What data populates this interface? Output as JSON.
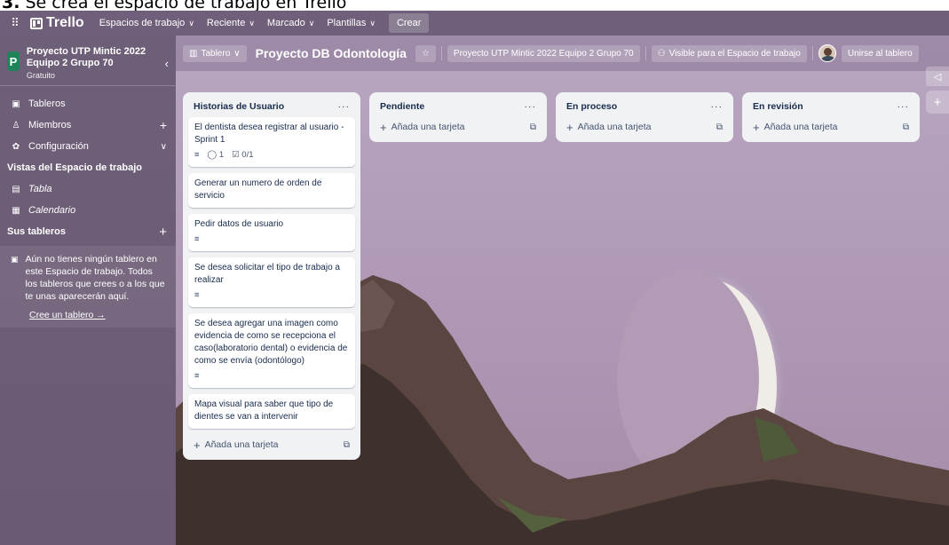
{
  "caption": {
    "number": "3.",
    "text": "Se crea el espacio de trabajo en Trello"
  },
  "topbar": {
    "logo": "Trello",
    "nav": [
      "Espacios de trabajo",
      "Reciente",
      "Marcado",
      "Plantillas"
    ],
    "create": "Crear"
  },
  "sidebar": {
    "workspace_avatar": "P",
    "workspace_name": "Proyecto UTP Mintic 2022 Equipo 2 Grupo 70",
    "workspace_plan": "Gratuito",
    "items": {
      "boards": "Tableros",
      "members": "Miembros",
      "settings": "Configuración"
    },
    "views_title": "Vistas del Espacio de trabajo",
    "views": {
      "table": "Tabla",
      "calendar": "Calendario"
    },
    "your_boards": "Sus tableros",
    "empty_info": "Aún no tienes ningún tablero en este Espacio de trabajo. Todos los tableros que crees o a los que te unas aparecerán aquí.",
    "create_board": "Cree un tablero →"
  },
  "board": {
    "view_button": "Tablero",
    "title": "Proyecto DB Odontología",
    "workspace_button": "Proyecto UTP Mintic 2022 Equipo 2 Grupo 70",
    "visibility": "Visible para el Espacio de trabajo",
    "join": "Unirse al tablero"
  },
  "lists": {
    "backlog": {
      "title": "Historias de Usuario",
      "cards": [
        {
          "text": "El dentista desea registrar al usuario - Sprint 1",
          "comments": "1",
          "checklist": "0/1"
        },
        {
          "text": "Generar un numero de orden de servicio"
        },
        {
          "text": "Pedir datos de usuario"
        },
        {
          "text": "Se desea solicitar el tipo de trabajo a realizar"
        },
        {
          "text": "Se desea agregar una imagen como evidencia de como se recepciona el caso(laboratorio dental) o evidencia de como se envía (odontólogo)"
        },
        {
          "text": "Mapa visual para saber que tipo de dientes se van a intervenir"
        }
      ]
    },
    "pending": {
      "title": "Pendiente"
    },
    "in_progress": {
      "title": "En proceso"
    },
    "review": {
      "title": "En revisión"
    },
    "add_card": "Añada una tarjeta",
    "more": "···"
  },
  "colors": {
    "topbar": "#6f5f7a",
    "workspace_avatar": "#1f845a",
    "list_bg": "#f1f2f4"
  }
}
